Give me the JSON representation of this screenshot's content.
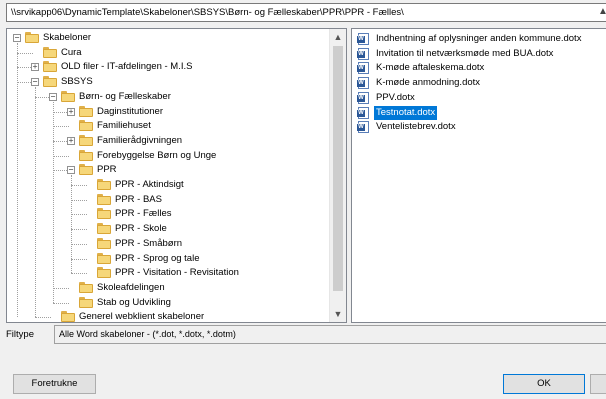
{
  "path": "\\\\srvikapp06\\DynamicTemplate\\Skabeloner\\SBSYS\\Børn- og Fælleskaber\\PPR\\PPR - Fælles\\",
  "icons": {
    "folder": "folder-icon",
    "document": "word-document-icon",
    "expander_plus": "+",
    "expander_minus": "−",
    "scroll_up": "▲",
    "scroll_down": "▼",
    "path_arrow": "▲"
  },
  "tree": {
    "items": [
      {
        "label": "Skabeloner",
        "expander": "−"
      },
      {
        "label": "Cura"
      },
      {
        "label": "OLD filer - IT-afdelingen - M.I.S",
        "expander": "+"
      },
      {
        "label": "SBSYS",
        "expander": "−"
      },
      {
        "label": "Børn- og Fælleskaber",
        "expander": "−"
      },
      {
        "label": "Daginstitutioner",
        "expander": "+"
      },
      {
        "label": "Familiehuset"
      },
      {
        "label": "Familierådgivningen",
        "expander": "+"
      },
      {
        "label": "Forebyggelse Børn og Unge"
      },
      {
        "label": "PPR",
        "expander": "−"
      },
      {
        "label": "PPR - Aktindsigt"
      },
      {
        "label": "PPR - BAS"
      },
      {
        "label": "PPR - Fælles"
      },
      {
        "label": "PPR - Skole"
      },
      {
        "label": "PPR - Småbørn"
      },
      {
        "label": "PPR - Sprog og tale"
      },
      {
        "label": "PPR - Visitation - Revisitation"
      },
      {
        "label": "Skoleafdelingen"
      },
      {
        "label": "Stab og Udvikling"
      },
      {
        "label": "Generel webklient skabeloner"
      }
    ]
  },
  "files": {
    "items": [
      {
        "label": "Indhentning af oplysninger anden kommune.dotx"
      },
      {
        "label": "Invitation til netværksmøde med BUA.dotx"
      },
      {
        "label": "K-møde aftaleskema.dotx"
      },
      {
        "label": "K-møde anmodning.dotx"
      },
      {
        "label": "PPV.dotx"
      },
      {
        "label": "Testnotat.dotx",
        "selected": true
      },
      {
        "label": "Ventelistebrev.dotx"
      }
    ]
  },
  "filetype": {
    "label": "Filtype",
    "value": "Alle Word skabeloner - (*.dot, *.dotx, *.dotm)"
  },
  "buttons": {
    "favorites": "Foretrukne",
    "ok": "OK"
  },
  "colors": {
    "selection": "#0078d7",
    "folder": "#f6d77a"
  }
}
